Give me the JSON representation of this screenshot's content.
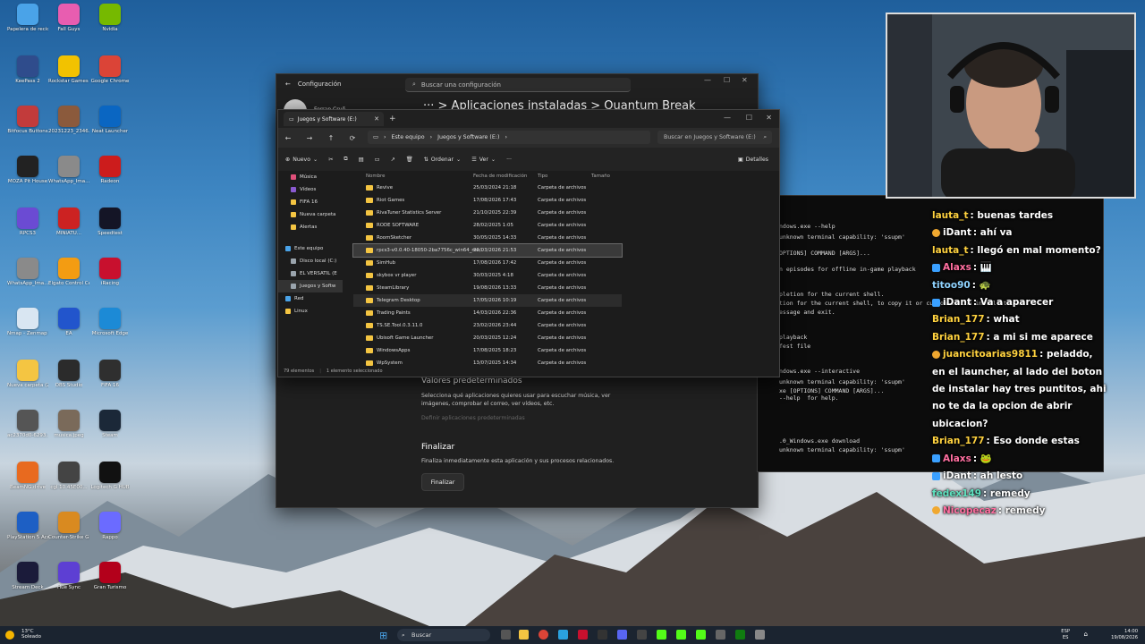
{
  "desktop": {
    "icons": [
      {
        "label": "Papelera de reciclaje",
        "color": "#4aa3e8"
      },
      {
        "label": "KeePass 2",
        "color": "#2f4c8c"
      },
      {
        "label": "Bitfocus Buttons",
        "color": "#c23b3b"
      },
      {
        "label": "MOZA Pit House",
        "color": "#222222"
      },
      {
        "label": "RPCS3",
        "color": "#6b4bd3"
      },
      {
        "label": "WhatsApp_Ima...",
        "color": "#8a8a8a"
      },
      {
        "label": "Nmap - Zenmap GUI",
        "color": "#d9e6f2"
      },
      {
        "label": "Nueva carpeta (2)",
        "color": "#f4c542"
      },
      {
        "label": "ac2370d0-6293...",
        "color": "#555555"
      },
      {
        "label": "BeamNG.drive",
        "color": "#e86a1f"
      },
      {
        "label": "PlayStation 5 Accessories",
        "color": "#1d5fc4"
      },
      {
        "label": "Stream Deck",
        "color": "#1b1b3a"
      },
      {
        "label": "Fall Guys",
        "color": "#e85db0"
      },
      {
        "label": "Rockstar Games Launcher",
        "color": "#f2c200"
      },
      {
        "label": "20231223_2346...",
        "color": "#8b5a3c"
      },
      {
        "label": "WhatsApp_Ima...",
        "color": "#8a8a8a"
      },
      {
        "label": "MINIATU...",
        "color": "#cc2222"
      },
      {
        "label": "Elgato Control Center",
        "color": "#f39c12"
      },
      {
        "label": "EA",
        "color": "#2255cc"
      },
      {
        "label": "OBS Studio",
        "color": "#2b2b2b"
      },
      {
        "label": "musica.jpeg",
        "color": "#7a6a5a"
      },
      {
        "label": "cgl 10.45E00...",
        "color": "#444444"
      },
      {
        "label": "Counter-Strike Global Offensive",
        "color": "#d98a20"
      },
      {
        "label": "Hue Sync",
        "color": "#5d3fd3"
      },
      {
        "label": "Nvidia",
        "color": "#76b900"
      },
      {
        "label": "Google Chrome",
        "color": "#db4437"
      },
      {
        "label": "Neat Launcher",
        "color": "#0a66c2"
      },
      {
        "label": "Radeon",
        "color": "#cc1c1c"
      },
      {
        "label": "Speedtest",
        "color": "#141526"
      },
      {
        "label": "iRacing",
        "color": "#c8102e"
      },
      {
        "label": "Microsoft Edge",
        "color": "#1c8ad6"
      },
      {
        "label": "FIFA 16",
        "color": "#2f2f2f"
      },
      {
        "label": "Steam",
        "color": "#1b2838"
      },
      {
        "label": "Logitech G HUB",
        "color": "#111111"
      },
      {
        "label": "Rappo",
        "color": "#6b6bff"
      },
      {
        "label": "Gran Turismo",
        "color": "#b3001b"
      }
    ]
  },
  "settings": {
    "title": "Configuración",
    "search_placeholder": "Buscar una configuración",
    "breadcrumb": "···  >  Aplicaciones instaladas  >  Quantum Break",
    "user": "Ferran Cruñ",
    "defaults_title": "Valores predeterminados",
    "defaults_text": "Selecciona qué aplicaciones quieres usar para escuchar música, ver imágenes, comprobar el correo, ver vídeos, etc.",
    "defaults_link": "Definir aplicaciones predeterminadas",
    "finalize_title": "Finalizar",
    "finalize_text": "Finaliza inmediatamente esta aplicación y sus procesos relacionados.",
    "finalize_button": "Finalizar"
  },
  "explorer": {
    "tab_title": "Juegos y Software (E:)",
    "breadcrumb": [
      "Este equipo",
      "Juegos y Software (E:)"
    ],
    "search_placeholder": "Buscar en Juegos y Software (E:)",
    "commands": {
      "new": "Nuevo",
      "sort": "Ordenar",
      "view": "Ver",
      "more": "···",
      "details": "Detalles"
    },
    "sidebar": [
      {
        "label": "Música",
        "color": "#e0507a"
      },
      {
        "label": "Vídeos",
        "color": "#8a5ad0"
      },
      {
        "label": "FIFA 16",
        "color": "#f4c542"
      },
      {
        "label": "Nueva carpeta",
        "color": "#f4c542"
      },
      {
        "label": "Alertas",
        "color": "#f4c542"
      },
      {
        "label": "Este equipo",
        "color": "#4aa3e8"
      },
      {
        "label": "Disco local (C:)",
        "color": "#9aa4ad"
      },
      {
        "label": "EL VERSATIL (E",
        "color": "#9aa4ad"
      },
      {
        "label": "Juegos y Softw",
        "color": "#9aa4ad"
      },
      {
        "label": "Red",
        "color": "#4aa3e8"
      },
      {
        "label": "Linux",
        "color": "#f4c542"
      }
    ],
    "columns": {
      "name": "Nombre",
      "date": "Fecha de modificación",
      "type": "Tipo",
      "size": "Tamaño"
    },
    "rows": [
      {
        "name": "Revive",
        "date": "25/03/2024 21:18",
        "type": "Carpeta de archivos"
      },
      {
        "name": "Riot Games",
        "date": "17/08/2026 17:43",
        "type": "Carpeta de archivos"
      },
      {
        "name": "RivaTuner Statistics Server",
        "date": "21/10/2025 22:39",
        "type": "Carpeta de archivos"
      },
      {
        "name": "RODE SOFTWARE",
        "date": "28/02/2025 1:05",
        "type": "Carpeta de archivos"
      },
      {
        "name": "RoomSketcher",
        "date": "30/05/2025 14:33",
        "type": "Carpeta de archivos"
      },
      {
        "name": "rpcs3-v0.0.40-18050-2ba7756c_win64_ms...",
        "date": "20/03/2026 21:53",
        "type": "Carpeta de archivos"
      },
      {
        "name": "SimHub",
        "date": "17/08/2026 17:42",
        "type": "Carpeta de archivos"
      },
      {
        "name": "skybox vr player",
        "date": "30/03/2025 4:18",
        "type": "Carpeta de archivos"
      },
      {
        "name": "SteamLibrary",
        "date": "19/08/2026 13:33",
        "type": "Carpeta de archivos"
      },
      {
        "name": "Telegram Desktop",
        "date": "17/05/2026 10:19",
        "type": "Carpeta de archivos"
      },
      {
        "name": "Trading Paints",
        "date": "14/03/2026 22:36",
        "type": "Carpeta de archivos"
      },
      {
        "name": "TS.SE.Tool.0.3.11.0",
        "date": "23/02/2026 23:44",
        "type": "Carpeta de archivos"
      },
      {
        "name": "Ubisoft Game Launcher",
        "date": "20/03/2025 12:24",
        "type": "Carpeta de archivos"
      },
      {
        "name": "WindowsApps",
        "date": "17/08/2025 18:23",
        "type": "Carpeta de archivos"
      },
      {
        "name": "WpSystem",
        "date": "13/07/2025 14:34",
        "type": "Carpeta de archivos"
      }
    ],
    "status_items": "79 elementos",
    "status_selected": "1 elemento seleccionado"
  },
  "terminal": {
    "lines": [
      {
        "text": "ndows.exe --help"
      },
      {
        "text": "unknown terminal capability: 'ssupm'"
      },
      {
        "text": "OPTIONS] COMMAND [ARGS]..."
      },
      {
        "text": "n episodes for offline in-game playback"
      },
      {
        "text": "pletion for the current shell."
      },
      {
        "text": "tion for the current shell, to copy it or customize the installation."
      },
      {
        "text": "essage and exit."
      },
      {
        "text": "playback"
      },
      {
        "text": "fest file"
      },
      {
        "text": "ndows.exe --interactive"
      },
      {
        "text": "unknown terminal capability: 'ssupm'"
      },
      {
        "text": "xe [OPTIONS] COMMAND [ARGS]..."
      },
      {
        "text": "--help  for help."
      },
      {
        "text": ".0_Windows.exe download"
      },
      {
        "text": "unknown terminal capability: 'ssupm'"
      }
    ]
  },
  "chat": {
    "messages": [
      {
        "user": "lauta_t",
        "user_color": "#ffd23f",
        "text": ": buenas tardes",
        "badge": ""
      },
      {
        "user": "iDant",
        "user_color": "#ffffff",
        "text": ": ahí va",
        "badge": "gold"
      },
      {
        "user": "lauta_t",
        "user_color": "#ffd23f",
        "text": ": llegó en mal momento?",
        "badge": ""
      },
      {
        "user": "Alaxs",
        "user_color": "#ff6fa0",
        "text": ": 🎹",
        "badge": "blue"
      },
      {
        "user": "titoo90",
        "user_color": "#8fd3ff",
        "text": ": 🐢",
        "badge": ""
      },
      {
        "user": "iDant",
        "user_color": "#ffffff",
        "text": ": Va a aparecer",
        "badge": "blue"
      },
      {
        "user": "Brian_177",
        "user_color": "#ffd23f",
        "text": ": what",
        "badge": ""
      },
      {
        "user": "Brian_177",
        "user_color": "#ffd23f",
        "text": ": a mi si me aparece",
        "badge": ""
      },
      {
        "user": "juancitoarias9811",
        "user_color": "#ffd23f",
        "text": ": peladdo, en el launcher, al lado del boton de instalar hay tres puntitos, ahi no te da la opcion de abrir ubicacion?",
        "badge": "gold"
      },
      {
        "user": "Brian_177",
        "user_color": "#ffd23f",
        "text": ": Eso donde estas",
        "badge": ""
      },
      {
        "user": "Alaxs",
        "user_color": "#ff6fa0",
        "text": ": 🐸",
        "badge": "blue"
      },
      {
        "user": "iDant",
        "user_color": "#ffffff",
        "text": ": ah lesto",
        "badge": "blue"
      },
      {
        "user": "fedex149",
        "user_color": "#5fe3c0",
        "text": ": remedy",
        "badge": ""
      },
      {
        "user": "Nicopecaz",
        "user_color": "#ff6fa0",
        "text": ": remedy",
        "badge": "gold"
      }
    ]
  },
  "taskbar": {
    "weather_temp": "13°C",
    "weather_text": "Soleado",
    "search_label": "Buscar",
    "lang_top": "ESP",
    "lang_bottom": "ES",
    "time": "14:00",
    "date": "19/08/2026"
  }
}
